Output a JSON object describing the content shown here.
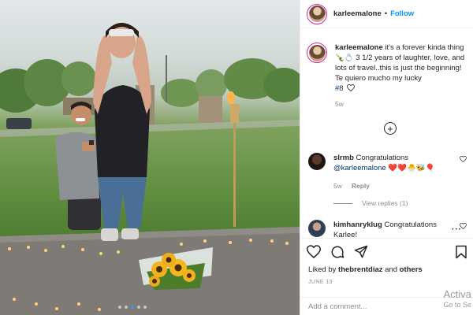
{
  "post": {
    "username": "karleemalone",
    "follow_label": "Follow",
    "separator": "•"
  },
  "caption": {
    "username": "karleemalone",
    "text": "it's a forever kinda thing 🍾💍 3 1/2 years of laughter, love, and lots of travel..this is just the beginning! Te quiero mucho my lucky",
    "tag": "#8",
    "time": "5w"
  },
  "comments": [
    {
      "username": "slrmb",
      "text": "Congratulations",
      "mention": "@karleemalone",
      "emojis": "❤️❤️🐣🐝🎈",
      "time": "5w",
      "reply_label": "Reply",
      "view_replies": "View replies (1)"
    },
    {
      "username": "kimhanryklug",
      "text": "Congratulations",
      "text_line2": "Karlee!"
    }
  ],
  "actions": {
    "liked_by_prefix": "Liked by",
    "liked_by_user": "thebrentdiaz",
    "liked_by_and": "and",
    "liked_by_others": "others",
    "date": "JUNE 13",
    "add_comment_placeholder": "Add a comment..."
  },
  "watermark": {
    "line1": "Activa",
    "line2": "Go to Se"
  },
  "carousel": {
    "dot_count": 5,
    "active_index": 2
  },
  "colors": {
    "accent": "#0095f6",
    "story_ring": "#d6249f",
    "text": "#262626",
    "muted": "#8e8e8e",
    "like_red": "#ed4956"
  },
  "icons": [
    "heart-icon",
    "comment-icon",
    "share-icon",
    "bookmark-icon",
    "add-circle-icon",
    "more-options-icon"
  ]
}
